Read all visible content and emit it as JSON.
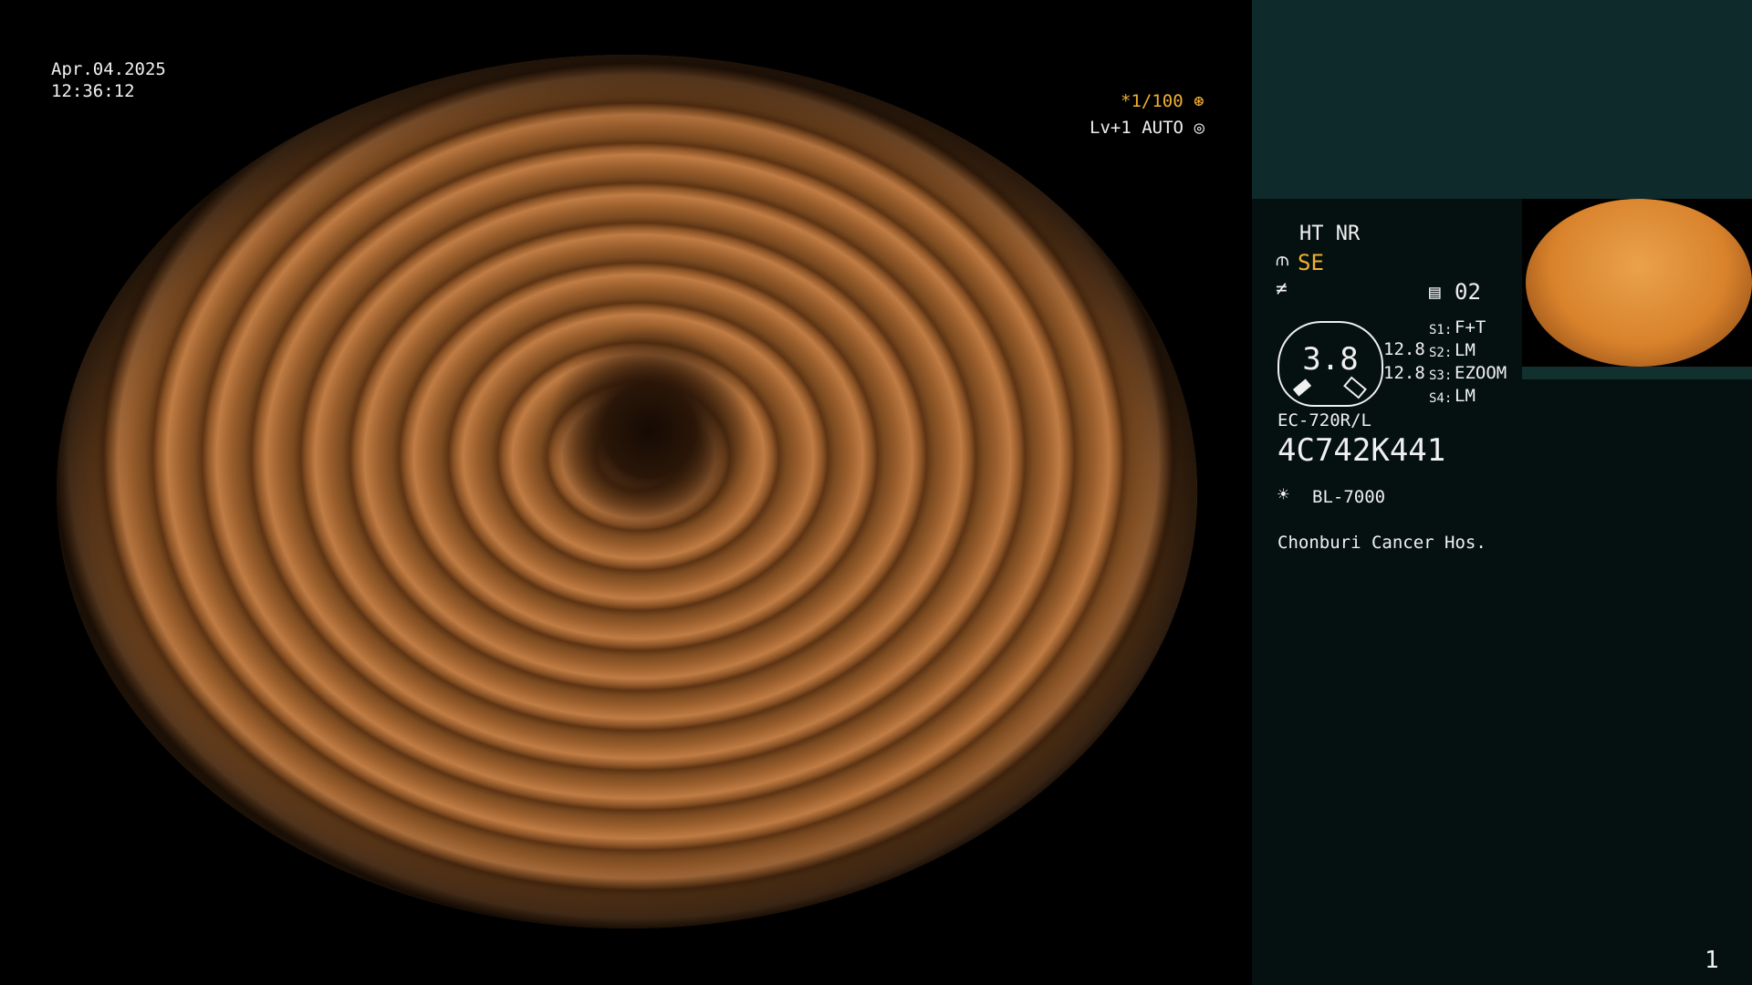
{
  "overlay": {
    "date": "Apr.04.2025",
    "time": "12:36:12",
    "shutter": "*1/100",
    "level": "Lv+1",
    "mode": "AUTO"
  },
  "panel": {
    "ht_nr": "HT NR",
    "enhance": "SE",
    "memory": "02",
    "gauge_value": "3.8",
    "gauge_side_top": "12.8",
    "gauge_side_bottom": "12.8",
    "switches": [
      {
        "label": "S1:",
        "value": "F+T"
      },
      {
        "label": "S2:",
        "value": "LM"
      },
      {
        "label": "S3:",
        "value": "EZOOM"
      },
      {
        "label": "S4:",
        "value": "LM"
      }
    ],
    "scope_model": "EC-720R/L",
    "serial": "4C742K441",
    "light_source": "BL-7000",
    "hospital": "Chonburi Cancer Hos."
  },
  "page_number": "1"
}
